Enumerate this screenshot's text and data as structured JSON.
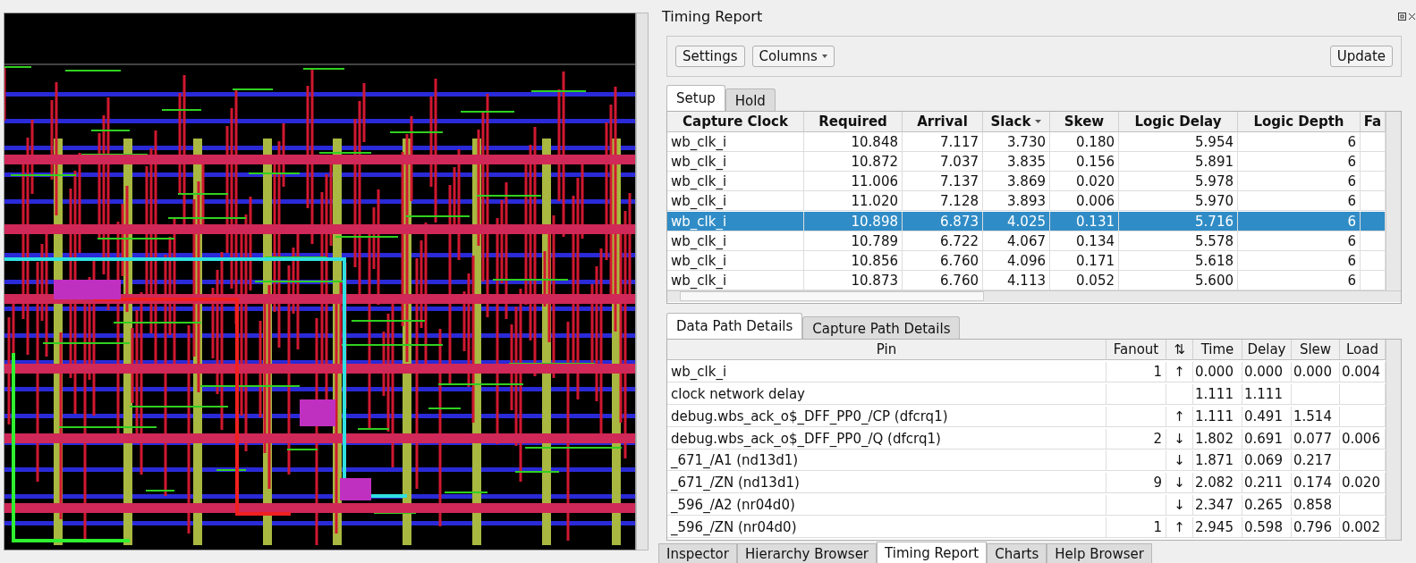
{
  "panel": {
    "title": "Timing Report"
  },
  "toolbar": {
    "buttons": [
      {
        "label": "Settings",
        "kind": "plain"
      },
      {
        "label": "Columns",
        "kind": "dropdown"
      }
    ],
    "update_button": "Update"
  },
  "path_tabs": [
    {
      "label": "Setup",
      "selected": true
    },
    {
      "label": "Hold",
      "selected": false
    }
  ],
  "paths_table": {
    "columns": [
      {
        "label": "Capture Clock",
        "sorted": false
      },
      {
        "label": "Required",
        "sorted": false
      },
      {
        "label": "Arrival",
        "sorted": false
      },
      {
        "label": "Slack",
        "sorted": true
      },
      {
        "label": "Skew",
        "sorted": false
      },
      {
        "label": "Logic Delay",
        "sorted": false
      },
      {
        "label": "Logic Depth",
        "sorted": false
      },
      {
        "label": "Fa",
        "sorted": false
      }
    ],
    "rows": [
      {
        "cells": [
          "wb_clk_i",
          "10.848",
          "7.117",
          "3.730",
          "0.180",
          "5.954",
          "6"
        ],
        "selected": false
      },
      {
        "cells": [
          "wb_clk_i",
          "10.872",
          "7.037",
          "3.835",
          "0.156",
          "5.891",
          "6"
        ],
        "selected": false
      },
      {
        "cells": [
          "wb_clk_i",
          "11.006",
          "7.137",
          "3.869",
          "0.020",
          "5.978",
          "6"
        ],
        "selected": false
      },
      {
        "cells": [
          "wb_clk_i",
          "11.020",
          "7.128",
          "3.893",
          "0.006",
          "5.970",
          "6"
        ],
        "selected": false
      },
      {
        "cells": [
          "wb_clk_i",
          "10.898",
          "6.873",
          "4.025",
          "0.131",
          "5.716",
          "6"
        ],
        "selected": true
      },
      {
        "cells": [
          "wb_clk_i",
          "10.789",
          "6.722",
          "4.067",
          "0.134",
          "5.578",
          "6"
        ],
        "selected": false
      },
      {
        "cells": [
          "wb_clk_i",
          "10.856",
          "6.760",
          "4.096",
          "0.171",
          "5.618",
          "6"
        ],
        "selected": false
      },
      {
        "cells": [
          "wb_clk_i",
          "10.873",
          "6.760",
          "4.113",
          "0.052",
          "5.600",
          "6"
        ],
        "selected": false
      }
    ]
  },
  "detail_tabs": [
    {
      "label": "Data Path Details",
      "selected": true
    },
    {
      "label": "Capture Path Details",
      "selected": false
    }
  ],
  "detail_table": {
    "columns": [
      "Pin",
      "Fanout",
      "⇅",
      "Time",
      "Delay",
      "Slew",
      "Load"
    ],
    "rows": [
      [
        "wb_clk_i",
        "1",
        "↑",
        "0.000",
        "0.000",
        "0.000",
        "0.004"
      ],
      [
        "clock network delay",
        "",
        "",
        "1.111",
        "1.111",
        "",
        ""
      ],
      [
        "debug.wbs_ack_o$_DFF_PP0_/CP (dfcrq1)",
        "",
        "↑",
        "1.111",
        "0.491",
        "1.514",
        ""
      ],
      [
        "debug.wbs_ack_o$_DFF_PP0_/Q (dfcrq1)",
        "2",
        "↓",
        "1.802",
        "0.691",
        "0.077",
        "0.006"
      ],
      [
        "_671_/A1 (nd13d1)",
        "",
        "↓",
        "1.871",
        "0.069",
        "0.217",
        ""
      ],
      [
        "_671_/ZN (nd13d1)",
        "9",
        "↓",
        "2.082",
        "0.211",
        "0.174",
        "0.020"
      ],
      [
        "_596_/A2 (nr04d0)",
        "",
        "↓",
        "2.347",
        "0.265",
        "0.858",
        ""
      ],
      [
        "_596_/ZN (nr04d0)",
        "1",
        "↑",
        "2.945",
        "0.598",
        "0.796",
        "0.002"
      ]
    ]
  },
  "dock_tabs": [
    {
      "label": "Inspector",
      "selected": false
    },
    {
      "label": "Hierarchy Browser",
      "selected": false
    },
    {
      "label": "Timing Report",
      "selected": true
    },
    {
      "label": "Charts",
      "selected": false
    },
    {
      "label": "Help Browser",
      "selected": false
    }
  ]
}
